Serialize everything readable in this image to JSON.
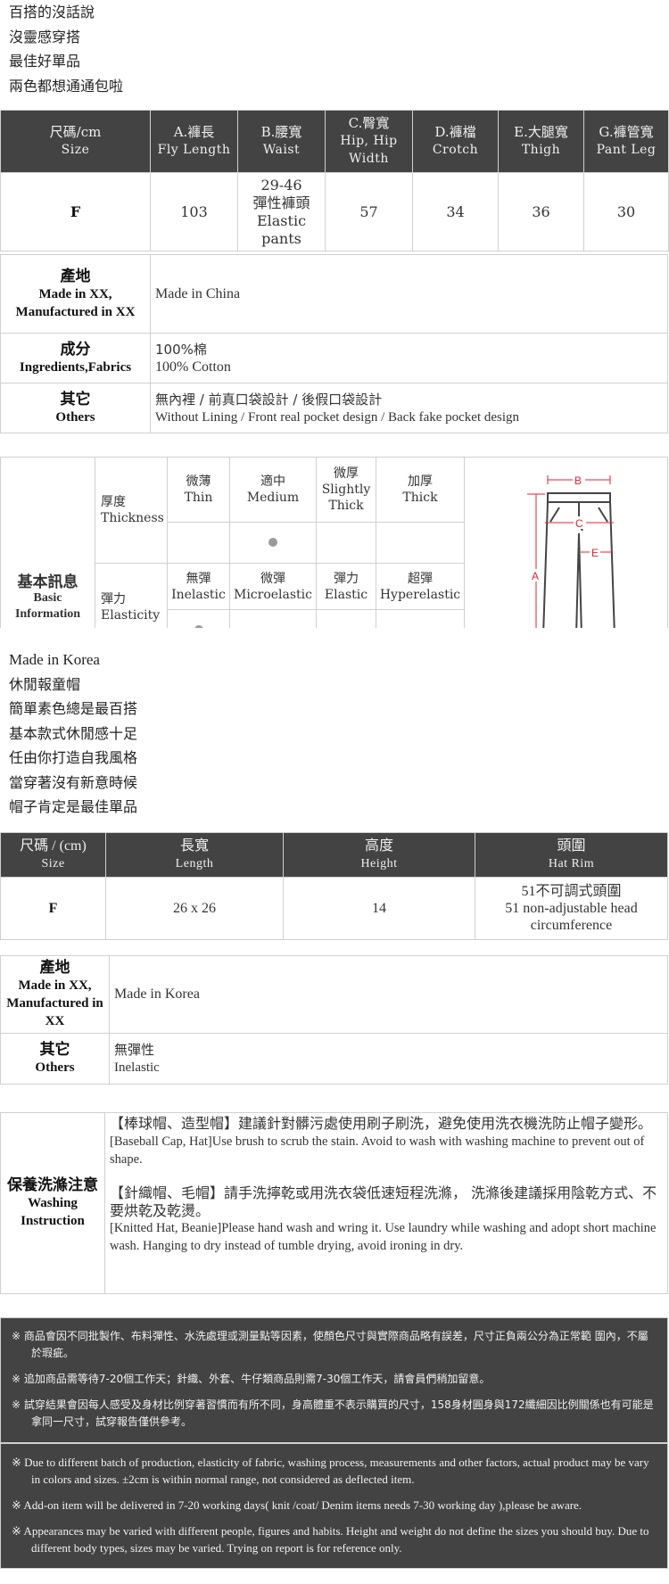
{
  "intro_pants": [
    "百搭的沒話說",
    "沒靈感穿搭",
    "最佳好單品",
    "兩色都想通通包啦"
  ],
  "pants_size_table": {
    "headers": [
      {
        "zh": "尺碼/cm",
        "en": "Size"
      },
      {
        "zh": "A.褲長",
        "en": "Fly Length"
      },
      {
        "zh": "B.腰寬",
        "en": "Waist"
      },
      {
        "zh": "C.臀寬",
        "en": "Hip, Hip Width"
      },
      {
        "zh": "D.褲檔",
        "en": "Crotch"
      },
      {
        "zh": "E.大腿寬",
        "en": "Thigh"
      },
      {
        "zh": "G.褲管寬",
        "en": "Pant Leg"
      }
    ],
    "rows": [
      {
        "size": "F",
        "fly_length": "103",
        "waist_range": "29-46",
        "waist_note_zh": "彈性褲頭",
        "waist_note_en": "Elastic pants",
        "hip": "57",
        "crotch": "34",
        "thigh": "36",
        "pant_leg": "30"
      }
    ]
  },
  "pants_info_table": [
    {
      "label_zh": "產地",
      "label_en": "Made in XX, Manufactured in XX",
      "value_zh": "",
      "value_en": "Made in China"
    },
    {
      "label_zh": "成分",
      "label_en": "Ingredients,Fabrics",
      "value_zh": "100%棉",
      "value_en": "100% Cotton"
    },
    {
      "label_zh": "其它",
      "label_en": "Others",
      "value_zh": "無內裡 / 前真口袋設計 / 後假口袋設計",
      "value_en": "Without Lining / Front real pocket design / Back fake pocket design"
    }
  ],
  "basic_info": {
    "label_zh": "基本訊息",
    "label_en": "Basic Information",
    "thickness": {
      "label_zh": "厚度",
      "label_en": "Thickness",
      "options": [
        {
          "zh": "微薄",
          "en": "Thin"
        },
        {
          "zh": "適中",
          "en": "Medium"
        },
        {
          "zh": "微厚",
          "en": "Slightly Thick"
        },
        {
          "zh": "加厚",
          "en": "Thick"
        }
      ],
      "selected": "Medium"
    },
    "elasticity": {
      "label_zh": "彈力",
      "label_en": "Elasticity",
      "options": [
        {
          "zh": "無彈",
          "en": "Inelastic"
        },
        {
          "zh": "微彈",
          "en": "Microelastic"
        },
        {
          "zh": "彈力",
          "en": "Elastic"
        },
        {
          "zh": "超彈",
          "en": "Hyperelastic"
        }
      ],
      "selected": "Inelastic"
    },
    "diagram_labels": [
      "A",
      "B",
      "C",
      "E"
    ],
    "diagram_colors": {
      "measure": "#e8212b",
      "outline": "#444444"
    }
  },
  "intro_hat": [
    "Made in Korea",
    "休閒報童帽",
    "簡單素色總是最百搭",
    "基本款式休閒感十足",
    "任由你打造自我風格",
    "當穿著沒有新意時候",
    "帽子肯定是最佳單品"
  ],
  "hat_size_table": {
    "headers": [
      {
        "zh": "尺碼 / (cm)",
        "en": "Size"
      },
      {
        "zh": "長寬",
        "en": "Length"
      },
      {
        "zh": "高度",
        "en": "Height"
      },
      {
        "zh": "頭圍",
        "en": "Hat Rim"
      }
    ],
    "rows": [
      {
        "size": "F",
        "length": "26 x 26",
        "height": "14",
        "rim_zh": "51不可調式頭圍",
        "rim_en": "51 non-adjustable head circumference"
      }
    ]
  },
  "hat_info_table": [
    {
      "label_zh": "產地",
      "label_en": "Made in XX, Manufactured in XX",
      "value_zh": "",
      "value_en": "Made in Korea"
    },
    {
      "label_zh": "其它",
      "label_en": "Others",
      "value_zh": "無彈性",
      "value_en": "Inelastic"
    }
  ],
  "washing": {
    "label_zh": "保養洗滌注意",
    "label_en": "Washing Instruction",
    "items": [
      {
        "zh": "【棒球帽、造型帽】建議針對髒污處使用刷子刷洗，避免使用洗衣機洗防止帽子變形。",
        "en": "[Baseball Cap, Hat]Use brush to scrub the stain. Avoid to wash with washing machine to prevent out of shape."
      },
      {
        "zh": "【針織帽、毛帽】請手洗擰乾或用洗衣袋低速短程洗滌， 洗滌後建議採用陰乾方式、不要烘乾及乾燙。",
        "en": "[Knitted Hat, Beanie]Please hand wash and wring it. Use laundry while washing and adopt short machine wash. Hanging to dry instead of tumble drying, avoid ironing in dry."
      }
    ]
  },
  "notes_zh": [
    "※ 商品會因不同批製作、布料彈性、水洗處理或測量點等因素，使顏色尺寸與實際商品略有誤差，尺寸正負兩公分為正常範 圍內，不屬於瑕疵。",
    "※ 追加商品需等待7-20個工作天；針織、外套、牛仔類商品則需7-30個工作天，請會員們稍加留意。",
    "※ 試穿結果會因每人感受及身材比例穿著習慣而有所不同，身高體重不表示購買的尺寸，158身材圓身與172纖細因比例關係也有可能是拿同一尺寸，試穿報告僅供參考。"
  ],
  "notes_en": [
    "※ Due to different batch of production, elasticity of fabric, washing process, measurements and other factors, actual product may be vary in colors and sizes. ±2cm is within normal range, not considered as deflected item.",
    "※ Add-on item will be delivered in 7-20 working days( knit /coat/ Denim items needs 7-30 working day ),please be aware.",
    "※ Appearances may be varied with different people, figures and habits. Height and weight do not define the sizes you should buy. Due to different body types, sizes may be varied. Trying on report is for reference only."
  ]
}
